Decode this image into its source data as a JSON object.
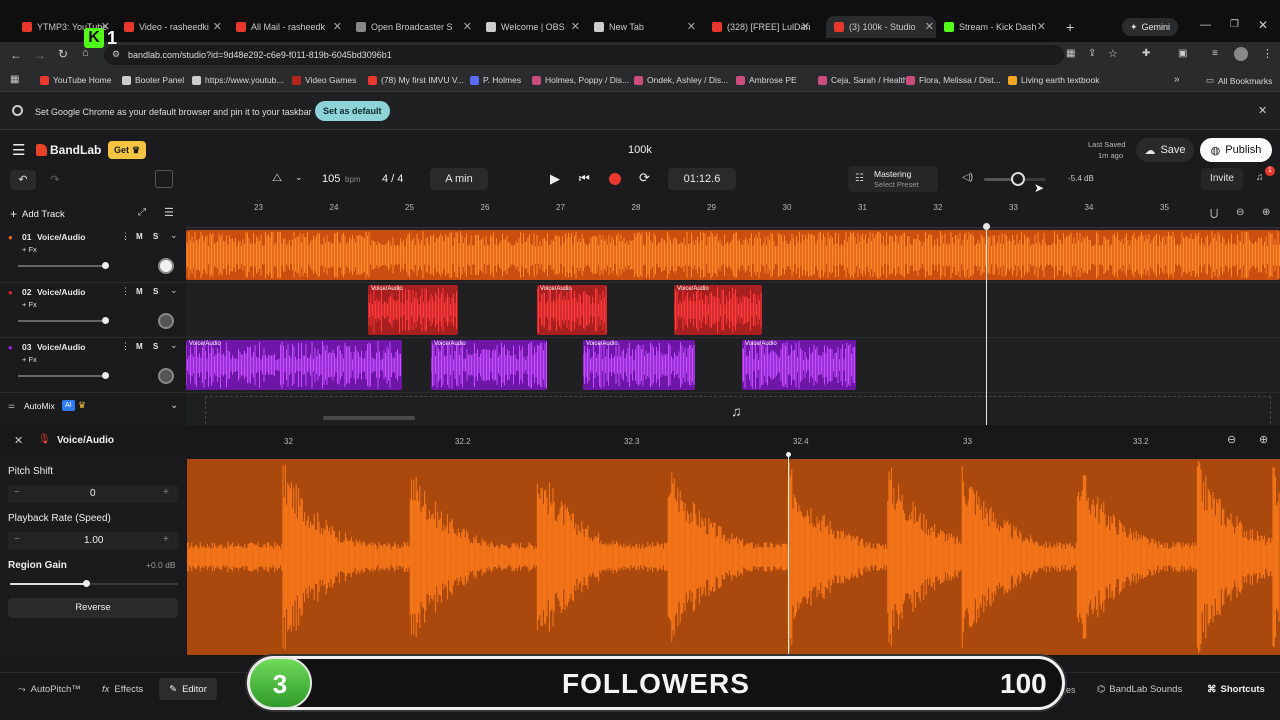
{
  "browser": {
    "tabs": [
      {
        "title": "YTMP3: YouTube",
        "color": "#e8372d"
      },
      {
        "title": "Video - rasheedki",
        "color": "#e8372d"
      },
      {
        "title": "All Mail - rasheedk",
        "color": "#e8372d"
      },
      {
        "title": "Open Broadcaster S",
        "color": "#888888"
      },
      {
        "title": "Welcome | OBS",
        "color": "#cccccc"
      },
      {
        "title": "New Tab",
        "color": "#cccccc"
      },
      {
        "title": "(328) [FREE] LulDan",
        "color": "#e8372d"
      },
      {
        "title": "(3) 100k - Studio",
        "color": "#e8372d"
      },
      {
        "title": "Stream - Kick Dash",
        "color": "#53fc18"
      }
    ],
    "new_tab_icon": "plus-icon",
    "gemini_label": "Gemini",
    "url": "bandlab.com/studio?id=9d48e292-c6e9-f011-819b-6045bd3096b1",
    "bookmarks": [
      {
        "label": "YouTube Home",
        "color": "#e8372d"
      },
      {
        "label": "Booter Panel",
        "color": "#cccccc"
      },
      {
        "label": "https://www.youtub...",
        "color": "#cccccc"
      },
      {
        "label": "Video Games",
        "color": "#b3261e"
      },
      {
        "label": "(78) My first IMVU V...",
        "color": "#e8372d"
      },
      {
        "label": "P. Holmes",
        "color": "#5a6cff"
      },
      {
        "label": "Holmes, Poppy / Dis...",
        "color": "#c94c7a"
      },
      {
        "label": "Ondek, Ashley / Dis...",
        "color": "#c94c7a"
      },
      {
        "label": "Ambrose PE",
        "color": "#c94c7a"
      },
      {
        "label": "Ceja, Sarah / Health...",
        "color": "#c94c7a"
      },
      {
        "label": "Flora, Melissa / Dist...",
        "color": "#c94c7a"
      },
      {
        "label": "Living earth textbook",
        "color": "#f5a623"
      }
    ],
    "all_bookmarks_label": "All Bookmarks",
    "infobar_text": "Set Google Chrome as your default browser and pin it to your taskbar",
    "infobar_button": "Set as default"
  },
  "app": {
    "brand": "BandLab",
    "get_label": "Get",
    "project_title": "100k",
    "last_saved_label": "Last Saved",
    "last_saved_value": "1m ago",
    "save_label": "Save",
    "publish_label": "Publish",
    "invite_label": "Invite",
    "notification_count": "1",
    "tempo": "105",
    "tempo_unit": "bpm",
    "time_signature": "4 / 4",
    "key": "A min",
    "time": "01:12.6",
    "mastering_label": "Mastering",
    "mastering_preset": "Select Preset",
    "master_volume": "-5.4 dB",
    "master_volume_level": 0.55,
    "accent": "#e8422a"
  },
  "timeline": {
    "add_track": "Add Track",
    "ticks": [
      "23",
      "24",
      "25",
      "26",
      "27",
      "28",
      "29",
      "30",
      "31",
      "32",
      "33",
      "34",
      "35"
    ],
    "tracks": [
      {
        "number": "01",
        "name": "Voice/Audio",
        "fx": "+ Fx",
        "mute": "M",
        "solo": "S",
        "color": "#f26a17"
      },
      {
        "number": "02",
        "name": "Voice/Audio",
        "fx": "+ Fx",
        "mute": "M",
        "solo": "S",
        "color": "#d42a2a"
      },
      {
        "number": "03",
        "name": "Voice/Audio",
        "fx": "+ Fx",
        "mute": "M",
        "solo": "S",
        "color": "#9a23e0"
      }
    ],
    "clip_label": "Voice/Audio",
    "automix_label": "AutoMix",
    "automix_badge": "AI"
  },
  "editor": {
    "track_name": "Voice/Audio",
    "ticks": [
      "32",
      "32.2",
      "32.3",
      "32.4",
      "33",
      "33.2"
    ],
    "pitch_shift_label": "Pitch Shift",
    "pitch_shift_value": "0",
    "playback_rate_label": "Playback Rate (Speed)",
    "playback_rate_value": "1.00",
    "region_gain_label": "Region Gain",
    "region_gain_value": "+0.0 dB",
    "region_gain_level": 0.45,
    "reverse_label": "Reverse"
  },
  "footer": {
    "autopitch": "AutoPitch™",
    "effects": "Effects",
    "editor": "Editor",
    "notes": "Notes",
    "sounds": "BandLab Sounds",
    "shortcuts": "Shortcuts"
  },
  "stream_overlay": {
    "count": "3",
    "label": "FOLLOWERS",
    "goal": "100",
    "kick_badge": "1"
  }
}
